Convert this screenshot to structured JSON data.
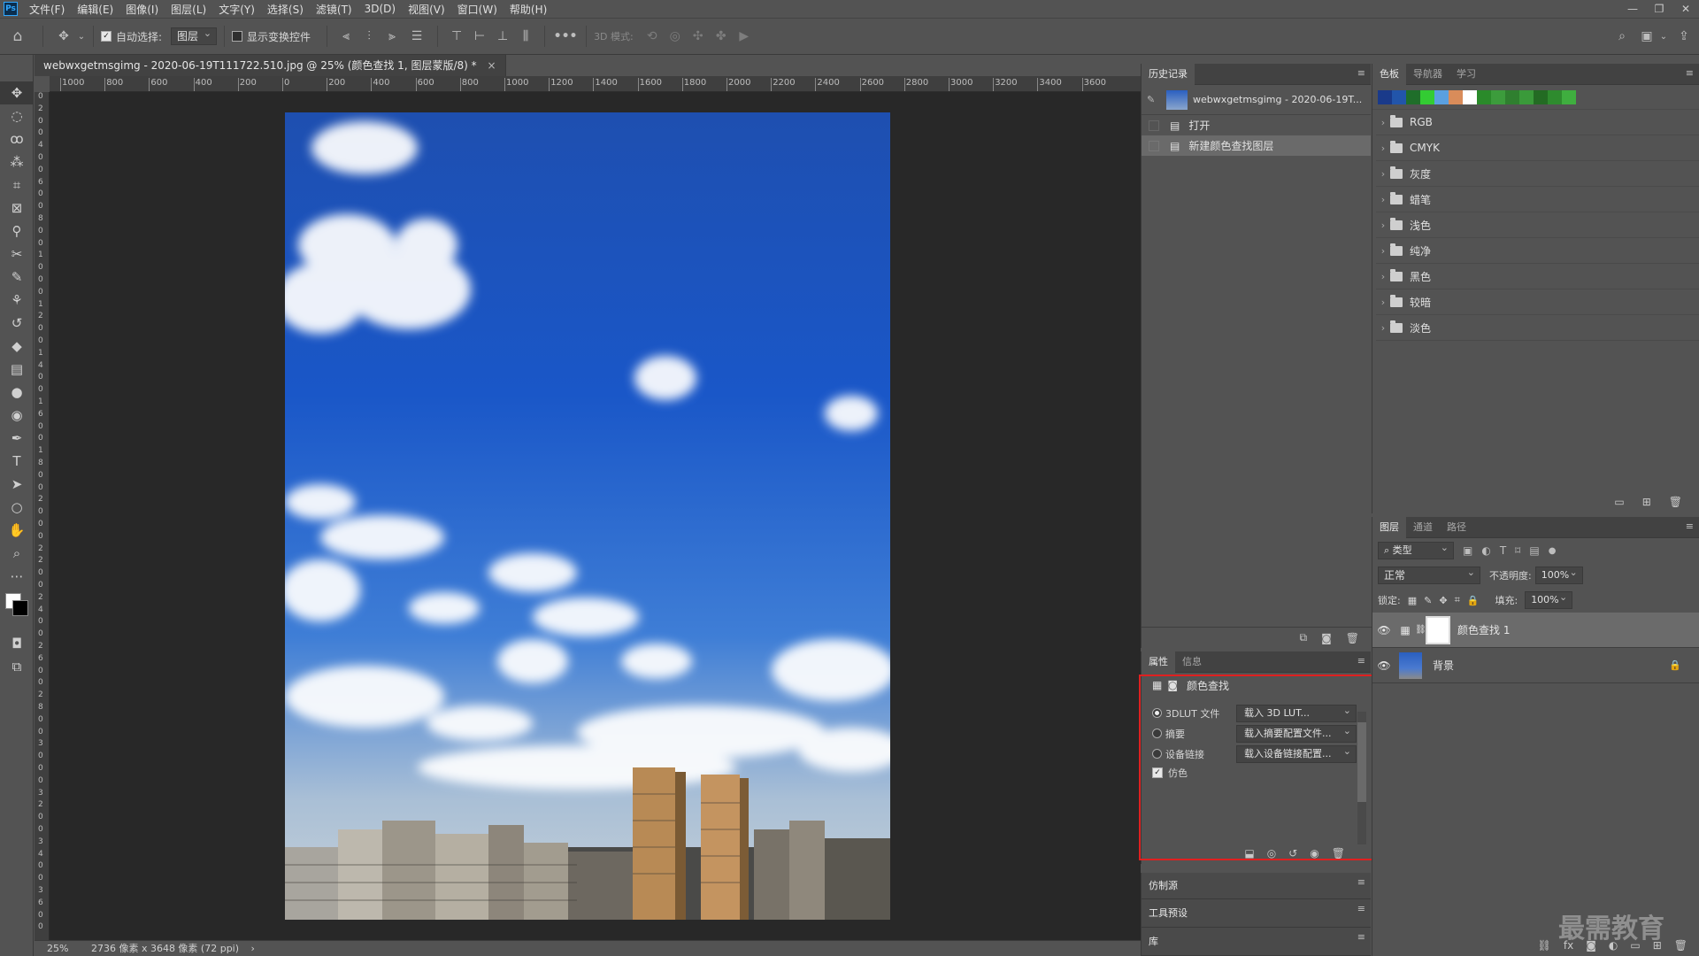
{
  "app": {
    "logo": "Ps"
  },
  "menu": [
    "文件(F)",
    "编辑(E)",
    "图像(I)",
    "图层(L)",
    "文字(Y)",
    "选择(S)",
    "滤镜(T)",
    "3D(D)",
    "视图(V)",
    "窗口(W)",
    "帮助(H)"
  ],
  "window_controls": {
    "minimize": "—",
    "restore": "❐",
    "close": "✕"
  },
  "options": {
    "auto_select_label": "自动选择:",
    "auto_select_value": "图层",
    "show_transform_label": "显示变换控件",
    "mode_3d_label": "3D 模式:",
    "more": "•••"
  },
  "document": {
    "tab_title": "webwxgetmsgimg - 2020-06-19T111722.510.jpg @ 25% (颜色查找 1, 图层蒙版/8) *",
    "tab_close": "×",
    "ruler_h": [
      "1000",
      "800",
      "600",
      "400",
      "200",
      "0",
      "200",
      "400",
      "600",
      "800",
      "1000",
      "1200",
      "1400",
      "1600",
      "1800",
      "2000",
      "2200",
      "2400",
      "2600",
      "2800",
      "3000",
      "3200",
      "3400",
      "3600"
    ],
    "ruler_v": [
      "0",
      "2",
      "0",
      "0",
      "4",
      "0",
      "0",
      "6",
      "0",
      "0",
      "8",
      "0",
      "0",
      "1",
      "0",
      "0",
      "0",
      "1",
      "2",
      "0",
      "0",
      "1",
      "4",
      "0",
      "0",
      "1",
      "6",
      "0",
      "0",
      "1",
      "8",
      "0",
      "0",
      "2",
      "0",
      "0",
      "0",
      "2",
      "2",
      "0",
      "0",
      "2",
      "4",
      "0",
      "0",
      "2",
      "6",
      "0",
      "0",
      "2",
      "8",
      "0",
      "0",
      "3",
      "0",
      "0",
      "0",
      "3",
      "2",
      "0",
      "0",
      "3",
      "4",
      "0",
      "0",
      "3",
      "6",
      "0",
      "0"
    ],
    "zoom": "25%",
    "status_info": "2736 像素 x 3648 像素 (72 ppi)",
    "status_arrow": "›"
  },
  "history": {
    "tab": "历史记录",
    "snapshot": "webwxgetmsgimg - 2020-06-19T...",
    "rows": [
      "打开",
      "新建颜色查找图层"
    ]
  },
  "swatches": {
    "tabs": [
      "色板",
      "导航器",
      "学习"
    ],
    "colors": [
      "#1a3a8a",
      "#2255aa",
      "#1f6e2a",
      "#33cc33",
      "#5aa0e0",
      "#d98c5a",
      "#ffffff",
      "#2a8a2a",
      "#3c9c3c",
      "#2f7f2f",
      "#3a9a3a",
      "#236b23",
      "#2e8b2e",
      "#3fae3f"
    ],
    "groups": [
      "RGB",
      "CMYK",
      "灰度",
      "蜡笔",
      "浅色",
      "纯净",
      "黑色",
      "较暗",
      "淡色"
    ]
  },
  "properties": {
    "tabs": [
      "属性",
      "信息"
    ],
    "title": "颜色查找",
    "rows": [
      {
        "label": "3DLUT 文件",
        "value": "载入 3D LUT...",
        "selected": true
      },
      {
        "label": "摘要",
        "value": "载入摘要配置文件...",
        "selected": false
      },
      {
        "label": "设备链接",
        "value": "载入设备链接配置...",
        "selected": false
      }
    ],
    "dither_label": "仿色"
  },
  "collapsed_panels": [
    "仿制源",
    "工具预设",
    "库"
  ],
  "layers": {
    "tabs": [
      "图层",
      "通道",
      "路径"
    ],
    "filter_value": "类型",
    "blend_mode": "正常",
    "opacity_label": "不透明度:",
    "opacity_value": "100%",
    "lock_label": "锁定:",
    "fill_label": "填充:",
    "fill_value": "100%",
    "items": [
      {
        "name": "颜色查找 1",
        "selected": true
      },
      {
        "name": "背景",
        "selected": false
      }
    ]
  },
  "watermark": "最需教育"
}
